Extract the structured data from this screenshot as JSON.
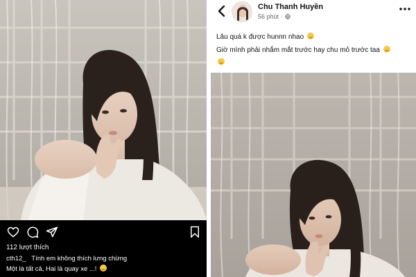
{
  "instagram": {
    "likes": "112 lượt thích",
    "caption_user": "cth12_",
    "caption_line1": "Tính em không thích lưng chừng",
    "caption_line2": "Một là tất cả, Hai là quay xe ...!",
    "icons": [
      "heart-icon",
      "comment-icon",
      "share-icon",
      "bookmark-icon"
    ],
    "photo_caption": "woman in white robe by sheer curtained window"
  },
  "facebook": {
    "author": "Chu Thanh Huyền",
    "time": "56 phút",
    "privacy_icon": "globe-icon",
    "text_line1": "Lâu quá k được hunnn nhao",
    "text_line2": "Giờ mình phải nhắm mắt trước hay chu mỏ trước taa",
    "icons": [
      "back-chevron-icon",
      "more-dots-icon"
    ]
  },
  "colors": {
    "ig_bg": "#000000",
    "fb_text": "#111111",
    "fb_meta": "#65676b",
    "emoji": "#f7c948"
  }
}
